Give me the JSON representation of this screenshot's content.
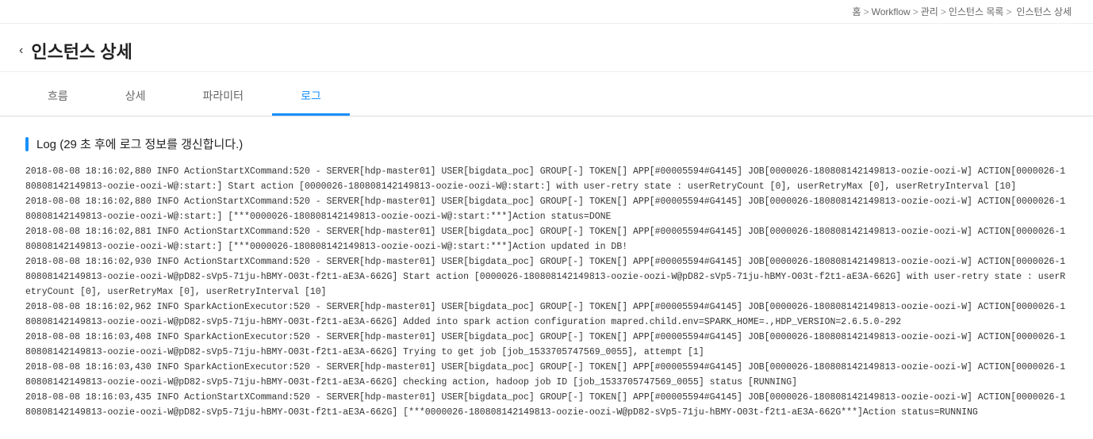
{
  "breadcrumb": {
    "home": "홈",
    "sep1": ">",
    "workflow": "Workflow",
    "sep2": ">",
    "manage": "관리",
    "sep3": ">",
    "instance_list": "인스턴스 목록",
    "sep4": ">",
    "instance_detail": "인스턴스 상세"
  },
  "page": {
    "back_icon": "‹",
    "title": "인스턴스 상세"
  },
  "tabs": [
    {
      "label": "흐름",
      "id": "flow",
      "active": false
    },
    {
      "label": "상세",
      "id": "detail",
      "active": false
    },
    {
      "label": "파라미터",
      "id": "params",
      "active": false
    },
    {
      "label": "로그",
      "id": "log",
      "active": true
    }
  ],
  "log": {
    "header": "Log (29 초 후에 로그 정보를 갱신합니다.)",
    "content": "2018-08-08 18:16:02,880 INFO ActionStartXCommand:520 - SERVER[hdp-master01] USER[bigdata_poc] GROUP[-] TOKEN[] APP[#00005594#G4145] JOB[0000026-180808142149813-oozie-oozi-W] ACTION[0000026-180808142149813-oozie-oozi-W@:start:] Start action [0000026-180808142149813-oozie-oozi-W@:start:] with user-retry state : userRetryCount [0], userRetryMax [0], userRetryInterval [10]\n2018-08-08 18:16:02,880 INFO ActionStartXCommand:520 - SERVER[hdp-master01] USER[bigdata_poc] GROUP[-] TOKEN[] APP[#00005594#G4145] JOB[0000026-180808142149813-oozie-oozi-W] ACTION[0000026-180808142149813-oozie-oozi-W@:start:] [***0000026-180808142149813-oozie-oozi-W@:start:***]Action status=DONE\n2018-08-08 18:16:02,881 INFO ActionStartXCommand:520 - SERVER[hdp-master01] USER[bigdata_poc] GROUP[-] TOKEN[] APP[#00005594#G4145] JOB[0000026-180808142149813-oozie-oozi-W] ACTION[0000026-180808142149813-oozie-oozi-W@:start:] [***0000026-180808142149813-oozie-oozi-W@:start:***]Action updated in DB!\n2018-08-08 18:16:02,930 INFO ActionStartXCommand:520 - SERVER[hdp-master01] USER[bigdata_poc] GROUP[-] TOKEN[] APP[#00005594#G4145] JOB[0000026-180808142149813-oozie-oozi-W] ACTION[0000026-180808142149813-oozie-oozi-W@pD82-sVp5-71ju-hBMY-O03t-f2t1-aE3A-662G] Start action [0000026-180808142149813-oozie-oozi-W@pD82-sVp5-71ju-hBMY-O03t-f2t1-aE3A-662G] with user-retry state : userRetryCount [0], userRetryMax [0], userRetryInterval [10]\n2018-08-08 18:16:02,962 INFO SparkActionExecutor:520 - SERVER[hdp-master01] USER[bigdata_poc] GROUP[-] TOKEN[] APP[#00005594#G4145] JOB[0000026-180808142149813-oozie-oozi-W] ACTION[0000026-180808142149813-oozie-oozi-W@pD82-sVp5-71ju-hBMY-O03t-f2t1-aE3A-662G] Added into spark action configuration mapred.child.env=SPARK_HOME=.,HDP_VERSION=2.6.5.0-292\n2018-08-08 18:16:03,408 INFO SparkActionExecutor:520 - SERVER[hdp-master01] USER[bigdata_poc] GROUP[-] TOKEN[] APP[#00005594#G4145] JOB[0000026-180808142149813-oozie-oozi-W] ACTION[0000026-180808142149813-oozie-oozi-W@pD82-sVp5-71ju-hBMY-O03t-f2t1-aE3A-662G] Trying to get job [job_1533705747569_0055], attempt [1]\n2018-08-08 18:16:03,430 INFO SparkActionExecutor:520 - SERVER[hdp-master01] USER[bigdata_poc] GROUP[-] TOKEN[] APP[#00005594#G4145] JOB[0000026-180808142149813-oozie-oozi-W] ACTION[0000026-180808142149813-oozie-oozi-W@pD82-sVp5-71ju-hBMY-O03t-f2t1-aE3A-662G] checking action, hadoop job ID [job_1533705747569_0055] status [RUNNING]\n2018-08-08 18:16:03,435 INFO ActionStartXCommand:520 - SERVER[hdp-master01] USER[bigdata_poc] GROUP[-] TOKEN[] APP[#00005594#G4145] JOB[0000026-180808142149813-oozie-oozi-W] ACTION[0000026-180808142149813-oozie-oozi-W@pD82-sVp5-71ju-hBMY-O03t-f2t1-aE3A-662G] [***0000026-180808142149813-oozie-oozi-W@pD82-sVp5-71ju-hBMY-O03t-f2t1-aE3A-662G***]Action status=RUNNING"
  }
}
